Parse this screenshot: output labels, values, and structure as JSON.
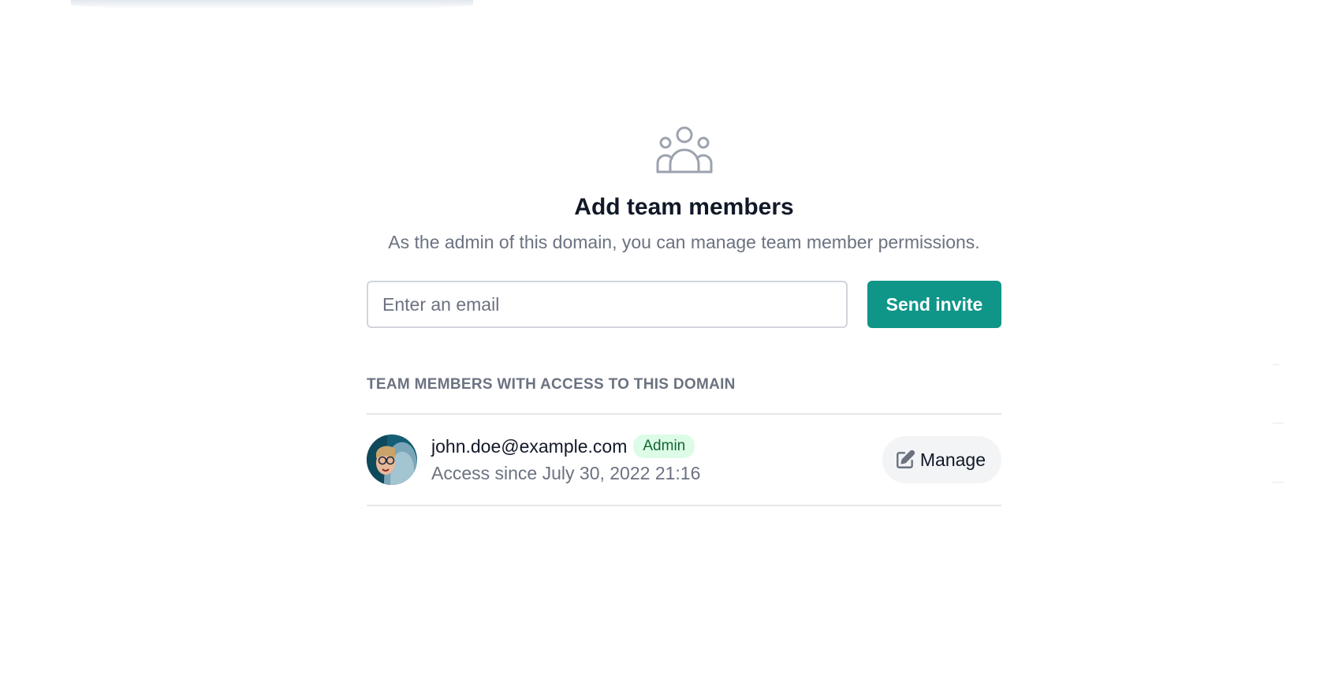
{
  "header": {
    "icon": "user-group-icon",
    "title": "Add team members",
    "subtitle": "As the admin of this domain, you can manage team member permissions."
  },
  "invite": {
    "email_placeholder": "Enter an email",
    "email_value": "",
    "send_label": "Send invite"
  },
  "members_section": {
    "heading": "TEAM MEMBERS WITH ACCESS TO THIS DOMAIN",
    "members": [
      {
        "email": "john.doe@example.com",
        "role": "Admin",
        "access_since": "Access since July 30, 2022 21:16",
        "manage_label": "Manage",
        "manage_icon": "pencil-square-icon",
        "avatar_icon": "avatar"
      }
    ]
  },
  "colors": {
    "primary": "#0f9688",
    "badge_bg": "#dcfce7",
    "badge_text": "#166534",
    "muted_text": "#6b7280",
    "border": "#e5e7eb"
  }
}
